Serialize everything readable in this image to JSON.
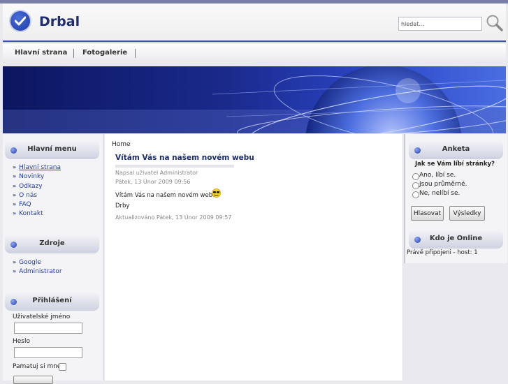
{
  "header": {
    "site_title": "Drbal",
    "search_placeholder": "hledat..."
  },
  "nav": {
    "items": [
      {
        "label": "Hlavní strana"
      },
      {
        "label": "Fotogalerie"
      }
    ]
  },
  "left": {
    "main_menu": {
      "title": "Hlavní menu",
      "items": [
        "Hlavní strana",
        "Novinky",
        "Odkazy",
        "O nás",
        "FAQ",
        "Kontakt"
      ]
    },
    "sources": {
      "title": "Zdroje",
      "items": [
        "Google",
        "Administrator"
      ]
    },
    "login": {
      "title": "Přihlášení",
      "username_label": "Uživatelské jméno",
      "password_label": "Heslo",
      "remember_label": "Pamatuj si mne"
    }
  },
  "main": {
    "breadcrumb": "Home",
    "article": {
      "title": "Vítám Vás na našem novém webu",
      "author_line": "Napsal uživatel Administrator",
      "date_line": "Pátek, 13 Únor 2009 09:56",
      "body_line": "Vítám Vás na našem novém webu",
      "body_line2": "Drby",
      "updated_line": "Aktualizováno Pátek, 13 Únor 2009 09:57"
    }
  },
  "right": {
    "poll": {
      "title": "Anketa",
      "question": "Jak se Vám líbí stránky?",
      "options": [
        "Ano, líbí se.",
        "Jsou průměrné.",
        "Ne, nelíbí se."
      ],
      "vote_button": "Hlasovat",
      "results_button": "Výsledky"
    },
    "online": {
      "title": "Kdo je Online",
      "text": "Právě připojeni - host: 1"
    }
  },
  "colors": {
    "accent": "#3b53b0",
    "link": "#223c9c"
  }
}
